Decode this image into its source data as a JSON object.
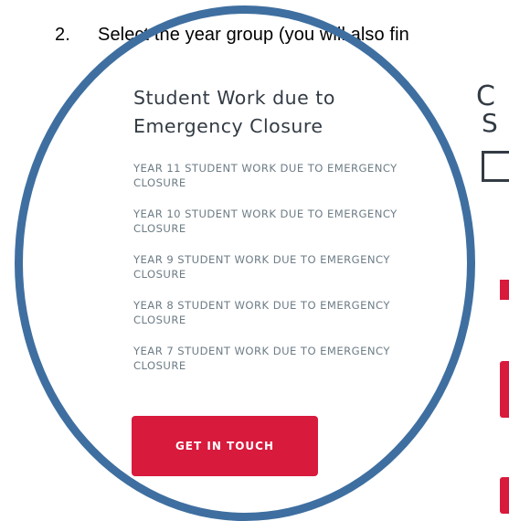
{
  "instruction": {
    "number": "2.",
    "text": "Select the year group (you will also fin"
  },
  "panel": {
    "title_line1": "Student Work due to",
    "title_line2": "Emergency Closure",
    "items": [
      {
        "line1": "YEAR 11 STUDENT WORK DUE TO EMERGENCY",
        "line2": "CLOSURE"
      },
      {
        "line1": "YEAR 10 STUDENT WORK DUE TO EMERGENCY",
        "line2": "CLOSURE"
      },
      {
        "line1": "YEAR 9 STUDENT WORK DUE TO EMERGENCY",
        "line2": "CLOSURE"
      },
      {
        "line1": "YEAR 8 STUDENT WORK DUE TO EMERGENCY",
        "line2": "CLOSURE"
      },
      {
        "line1": "YEAR 7 STUDENT WORK DUE TO EMERGENCY",
        "line2": "CLOSURE"
      }
    ],
    "button_label": "GET IN TOUCH"
  },
  "right_partial": {
    "letter1": "C",
    "letter2": "S"
  },
  "colors": {
    "accent_red": "#d81a3d",
    "magnifier_blue": "#3f6fa0",
    "heading_text": "#333b44",
    "link_text": "#6d7c86"
  }
}
